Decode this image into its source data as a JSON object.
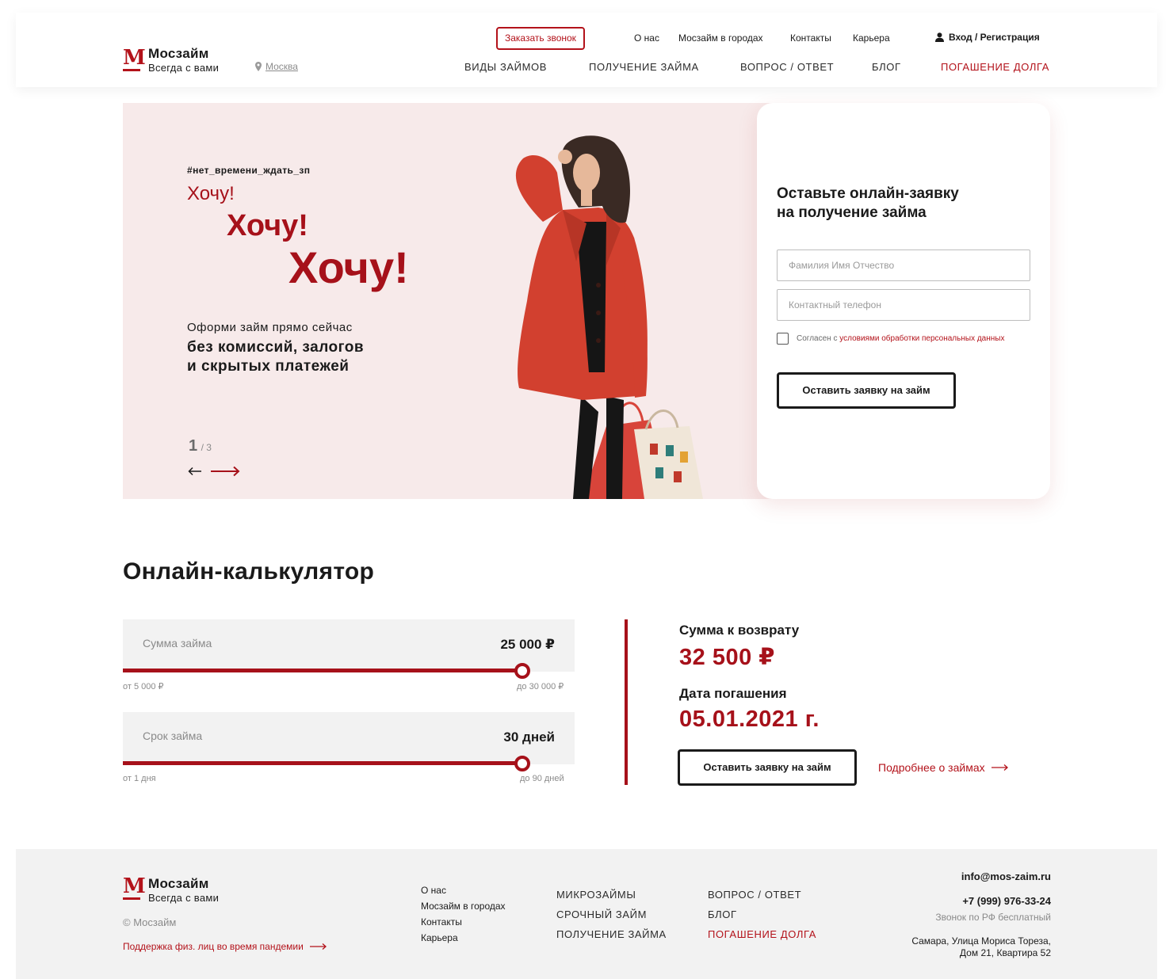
{
  "brand": {
    "name": "Мосзайм",
    "tagline": "Всегда с вами",
    "logo_letter": "M",
    "accent_color": "#b3121a"
  },
  "header": {
    "city": "Москва",
    "callback_label": "Заказать звонок",
    "top_links": [
      "О нас",
      "Мосзайм в городах",
      "Контакты",
      "Карьера"
    ],
    "login_label": "Вход / Регистрация",
    "main_nav": [
      "ВИДЫ ЗАЙМОВ",
      "ПОЛУЧЕНИЕ ЗАЙМА",
      "ВОПРОС / ОТВЕТ",
      "БЛОГ",
      "ПОГАШЕНИЕ ДОЛГА"
    ]
  },
  "hero": {
    "hashtag": "#нет_времени_ждать_зп",
    "want_1": "Хочу!",
    "want_2": "Хочу!",
    "want_3": "Хочу!",
    "lead": "Оформи займ прямо сейчас",
    "bold_line_1": "без комиссий, залогов",
    "bold_line_2": "и скрытых платежей",
    "slide_current": "1",
    "slide_total": "/ 3"
  },
  "form": {
    "title_line_1": "Оставьте онлайн-заявку",
    "title_line_2": "на получение займа",
    "name_placeholder": "Фамилия Имя Отчество",
    "phone_placeholder": "Контактный телефон",
    "consent_text": "Согласен с",
    "consent_link": "условиями обработки персональных данных",
    "consent_checked": false,
    "submit_label": "Оставить заявку на займ"
  },
  "calculator": {
    "title": "Онлайн-калькулятор",
    "amount": {
      "label": "Сумма займа",
      "value": "25 000 ₽",
      "min_label": "от 5 000 ₽",
      "max_label": "до 30 000 ₽",
      "min": 5000,
      "max": 30000,
      "current": 25000
    },
    "term": {
      "label": "Срок займа",
      "value": "30 дней",
      "min_label": "от 1 дня",
      "max_label": "до 90 дней",
      "min": 1,
      "max": 90,
      "current": 30
    },
    "result": {
      "return_label": "Сумма к возврату",
      "return_value": "32 500 ₽",
      "date_label": "Дата погашения",
      "date_value": "05.01.2021 г.",
      "submit_label": "Оставить заявку на займ",
      "more_label": "Подробнее о займах"
    }
  },
  "footer": {
    "copyright": "© Мосзайм",
    "support_label": "Поддержка физ. лиц во время пандемии",
    "links": [
      "О нас",
      "Мосзайм в городах",
      "Контакты",
      "Карьера"
    ],
    "nav_col_1": [
      "МИКРОЗАЙМЫ",
      "СРОЧНЫЙ ЗАЙМ",
      "ПОЛУЧЕНИЕ ЗАЙМА"
    ],
    "nav_col_2": [
      "ВОПРОС / ОТВЕТ",
      "БЛОГ",
      "ПОГАШЕНИЕ ДОЛГА"
    ],
    "email": "info@mos-zaim.ru",
    "phone": "+7 (999) 976-33-24",
    "phone_note": "Звонок по РФ бесплатный",
    "address_line_1": "Самара, Улица Мориса Тореза,",
    "address_line_2": "Дом 21, Квартира 52"
  }
}
